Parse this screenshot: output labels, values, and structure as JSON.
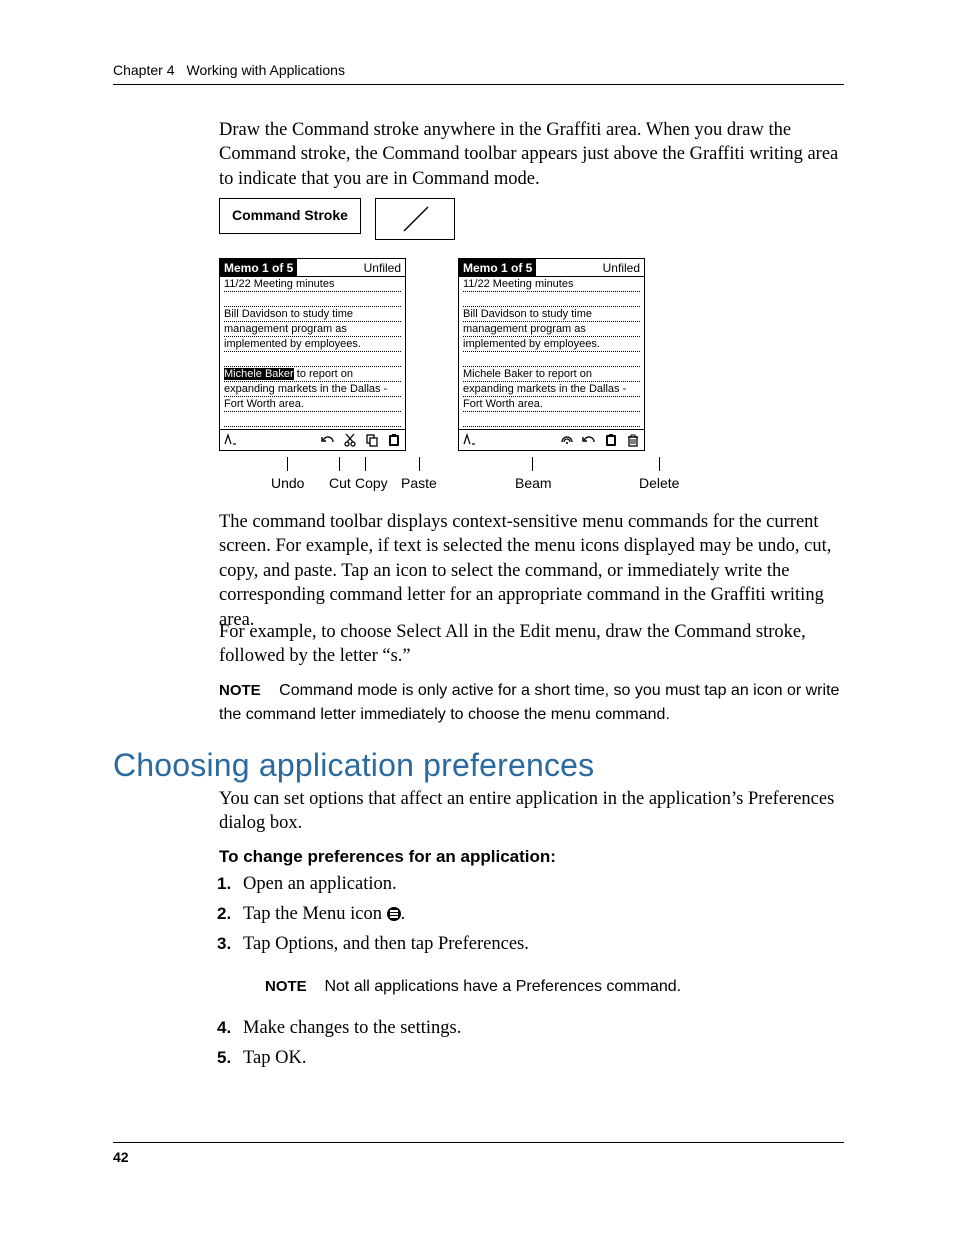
{
  "header": {
    "chapter": "Chapter 4",
    "title": "Working with Applications"
  },
  "page_number": "42",
  "paragraphs": {
    "p1": "Draw the Command stroke anywhere in the Graffiti area. When you draw the Command stroke, the Command toolbar appears just above the Graffiti writing area to indicate that you are in Command mode.",
    "p2": "The command toolbar displays context-sensitive menu commands for the current screen. For example, if text is selected the menu icons displayed may be undo, cut, copy, and paste. Tap an icon to select the command, or immediately write the corresponding command letter for an appropriate command in the Graffiti writing area.",
    "p3": "For example, to choose Select All in the Edit menu, draw the Command stroke, followed by the letter “s.”",
    "p4": "You can set options that affect an entire application in the application’s Preferences dialog box."
  },
  "note1": {
    "label": "NOTE",
    "body": "Command mode is only active for a short time, so you must tap an icon or write the command letter immediately to choose the menu command."
  },
  "heading": "Choosing application preferences",
  "subheading": "To change preferences for an application:",
  "steps": {
    "s1": "Open an application.",
    "s2_pre": "Tap the Menu icon ",
    "s2_post": ".",
    "s3": "Tap Options, and then tap Preferences.",
    "s4": "Make changes to the settings.",
    "s5": "Tap OK."
  },
  "note2": {
    "label": "NOTE",
    "body": "Not all applications have a Preferences command."
  },
  "fig": {
    "cmd_label": "Command Stroke",
    "title_black": "Memo 1 of 5",
    "title_cat": "Unfiled",
    "lines": {
      "l1": "11/22 Meeting minutes",
      "l3": "Bill Davidson to study time",
      "l4": "management program as",
      "l5": "implemented by employees.",
      "l7a": "Michele Baker",
      "l7b": " to report on",
      "l8": "expanding markets in the Dallas -",
      "l9": "Fort Worth area."
    },
    "captions": {
      "undo": "Undo",
      "cut": "Cut",
      "copy": "Copy",
      "paste": "Paste",
      "beam": "Beam",
      "delete": "Delete"
    }
  }
}
